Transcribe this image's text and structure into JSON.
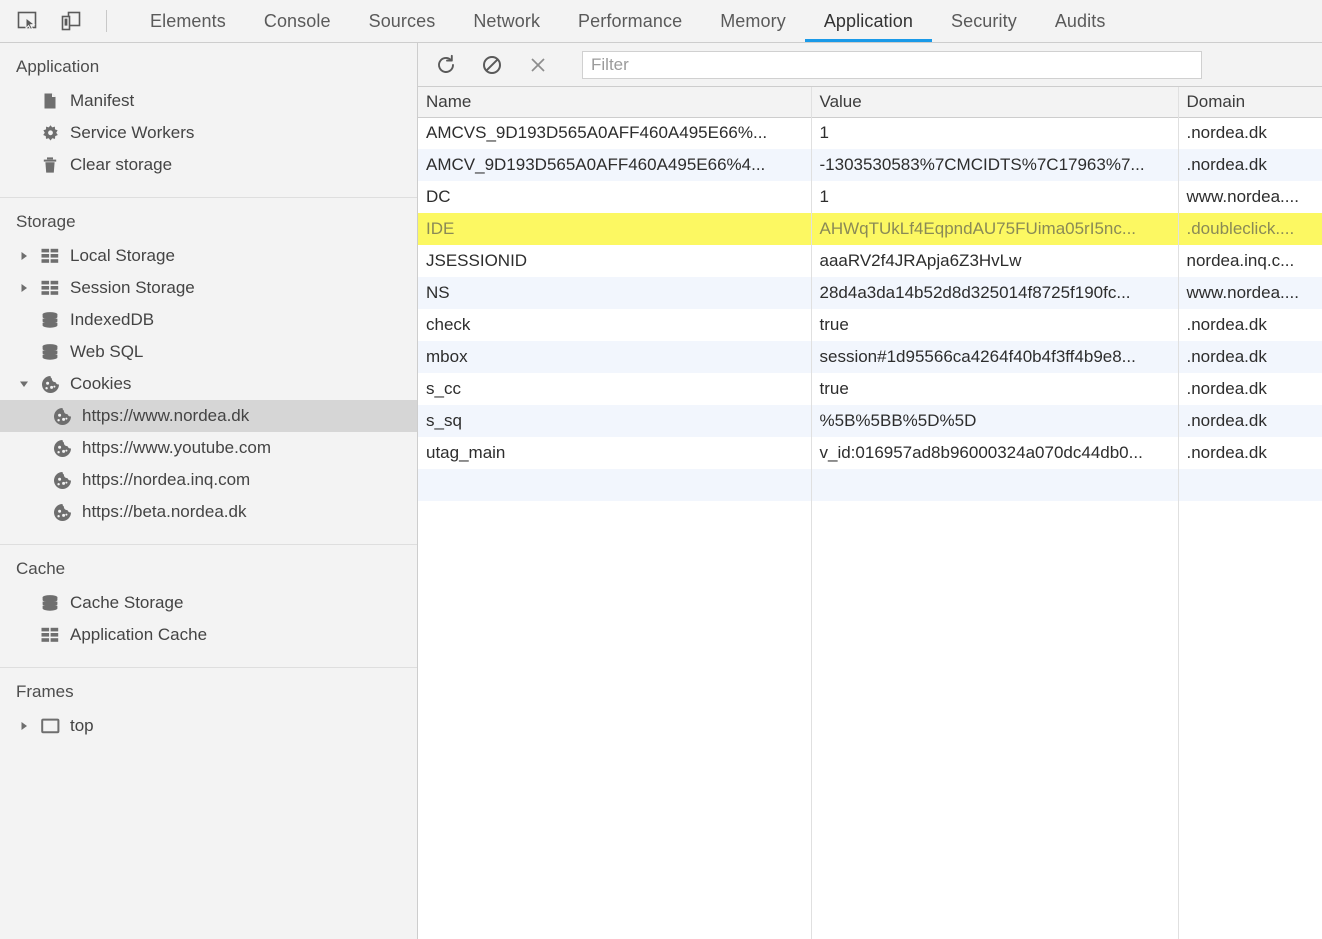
{
  "toolbar_icons": {
    "inspect": "inspect-element-icon",
    "device": "device-toolbar-icon"
  },
  "tabs": [
    {
      "label": "Elements",
      "active": false
    },
    {
      "label": "Console",
      "active": false
    },
    {
      "label": "Sources",
      "active": false
    },
    {
      "label": "Network",
      "active": false
    },
    {
      "label": "Performance",
      "active": false
    },
    {
      "label": "Memory",
      "active": false
    },
    {
      "label": "Application",
      "active": true
    },
    {
      "label": "Security",
      "active": false
    },
    {
      "label": "Audits",
      "active": false
    }
  ],
  "accent_color": "#1a9ae8",
  "highlight_color": "#fcf862",
  "sidebar": {
    "sections": [
      {
        "title": "Application",
        "items": [
          {
            "label": "Manifest",
            "icon": "document-icon",
            "arrow": "none",
            "indent": 1,
            "selected": false
          },
          {
            "label": "Service Workers",
            "icon": "gear-icon",
            "arrow": "none",
            "indent": 1,
            "selected": false
          },
          {
            "label": "Clear storage",
            "icon": "trash-icon",
            "arrow": "none",
            "indent": 1,
            "selected": false
          }
        ]
      },
      {
        "title": "Storage",
        "items": [
          {
            "label": "Local Storage",
            "icon": "table-icon",
            "arrow": "collapsed",
            "indent": 1,
            "selected": false
          },
          {
            "label": "Session Storage",
            "icon": "table-icon",
            "arrow": "collapsed",
            "indent": 1,
            "selected": false
          },
          {
            "label": "IndexedDB",
            "icon": "database-icon",
            "arrow": "none",
            "indent": 1,
            "selected": false
          },
          {
            "label": "Web SQL",
            "icon": "database-icon",
            "arrow": "none",
            "indent": 1,
            "selected": false
          },
          {
            "label": "Cookies",
            "icon": "cookie-icon",
            "arrow": "expanded",
            "indent": 1,
            "selected": false
          },
          {
            "label": "https://www.nordea.dk",
            "icon": "cookie-icon",
            "arrow": "none",
            "indent": 2,
            "selected": true
          },
          {
            "label": "https://www.youtube.com",
            "icon": "cookie-icon",
            "arrow": "none",
            "indent": 2,
            "selected": false
          },
          {
            "label": "https://nordea.inq.com",
            "icon": "cookie-icon",
            "arrow": "none",
            "indent": 2,
            "selected": false
          },
          {
            "label": "https://beta.nordea.dk",
            "icon": "cookie-icon",
            "arrow": "none",
            "indent": 2,
            "selected": false
          }
        ]
      },
      {
        "title": "Cache",
        "items": [
          {
            "label": "Cache Storage",
            "icon": "database-icon",
            "arrow": "none",
            "indent": 1,
            "selected": false
          },
          {
            "label": "Application Cache",
            "icon": "table-icon",
            "arrow": "none",
            "indent": 1,
            "selected": false
          }
        ]
      },
      {
        "title": "Frames",
        "items": [
          {
            "label": "top",
            "icon": "frame-icon",
            "arrow": "collapsed",
            "indent": 1,
            "selected": false
          }
        ]
      }
    ]
  },
  "main_toolbar": {
    "refresh_label": "refresh-icon",
    "clear_label": "clear-icon",
    "close_label": "close-icon",
    "filter_placeholder": "Filter",
    "filter_value": ""
  },
  "table": {
    "columns": [
      "Name",
      "Value",
      "Domain"
    ],
    "rows": [
      {
        "name": "AMCVS_9D193D565A0AFF460A495E66%...",
        "value": "1",
        "domain": ".nordea.dk",
        "highlight": false
      },
      {
        "name": "AMCV_9D193D565A0AFF460A495E66%4...",
        "value": "-1303530583%7CMCIDTS%7C17963%7...",
        "domain": ".nordea.dk",
        "highlight": false
      },
      {
        "name": "DC",
        "value": "1",
        "domain": "www.nordea....",
        "highlight": false
      },
      {
        "name": "IDE",
        "value": "AHWqTUkLf4EqpndAU75FUima05rI5nc...",
        "domain": ".doubleclick....",
        "highlight": true
      },
      {
        "name": "JSESSIONID",
        "value": "aaaRV2f4JRApja6Z3HvLw",
        "domain": "nordea.inq.c...",
        "highlight": false
      },
      {
        "name": "NS",
        "value": "28d4a3da14b52d8d325014f8725f190fc...",
        "domain": "www.nordea....",
        "highlight": false
      },
      {
        "name": "check",
        "value": "true",
        "domain": ".nordea.dk",
        "highlight": false
      },
      {
        "name": "mbox",
        "value": "session#1d95566ca4264f40b4f3ff4b9e8...",
        "domain": ".nordea.dk",
        "highlight": false
      },
      {
        "name": "s_cc",
        "value": "true",
        "domain": ".nordea.dk",
        "highlight": false
      },
      {
        "name": "s_sq",
        "value": "%5B%5BB%5D%5D",
        "domain": ".nordea.dk",
        "highlight": false
      },
      {
        "name": "utag_main",
        "value": "v_id:016957ad8b96000324a070dc44db0...",
        "domain": ".nordea.dk",
        "highlight": false
      },
      {
        "name": "",
        "value": "",
        "domain": "",
        "highlight": false
      }
    ]
  }
}
